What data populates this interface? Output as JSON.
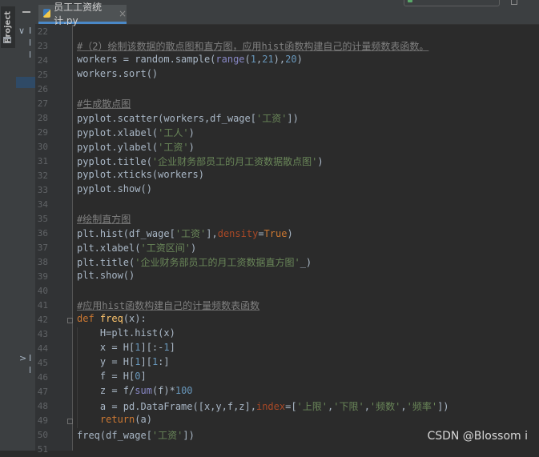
{
  "sidebar": {
    "project_label": "Project"
  },
  "tab": {
    "filename": "员工工资统计.py",
    "close_glyph": "×"
  },
  "tree": {
    "chevron_open": "∨",
    "chevron_closed": ">"
  },
  "lines": [
    {
      "n": "22",
      "segs": []
    },
    {
      "n": "23",
      "segs": [
        {
          "t": "#（2）绘制该数据的散点图和直方图，应用hist函数构建自己的计量频数表函数。",
          "c": "cm"
        }
      ]
    },
    {
      "n": "24",
      "segs": [
        {
          "t": "workers = random.sample("
        },
        {
          "t": "range",
          "c": "bi"
        },
        {
          "t": "("
        },
        {
          "t": "1",
          "c": "num"
        },
        {
          "t": ","
        },
        {
          "t": "21",
          "c": "num"
        },
        {
          "t": "),"
        },
        {
          "t": "20",
          "c": "num"
        },
        {
          "t": ")"
        }
      ]
    },
    {
      "n": "25",
      "segs": [
        {
          "t": "workers.sort()"
        }
      ]
    },
    {
      "n": "26",
      "segs": []
    },
    {
      "n": "27",
      "segs": [
        {
          "t": "#生成散点图",
          "c": "cm"
        }
      ]
    },
    {
      "n": "28",
      "segs": [
        {
          "t": "pyplot.scatter(workers,df_wage["
        },
        {
          "t": "'工资'",
          "c": "str"
        },
        {
          "t": "])"
        }
      ]
    },
    {
      "n": "29",
      "segs": [
        {
          "t": "pyplot.xlabel("
        },
        {
          "t": "'工人'",
          "c": "str"
        },
        {
          "t": ")"
        }
      ]
    },
    {
      "n": "30",
      "segs": [
        {
          "t": "pyplot.ylabel("
        },
        {
          "t": "'工资'",
          "c": "str"
        },
        {
          "t": ")"
        }
      ]
    },
    {
      "n": "31",
      "segs": [
        {
          "t": "pyplot.title("
        },
        {
          "t": "'企业财务部员工的月工资数据散点图'",
          "c": "str"
        },
        {
          "t": ")"
        }
      ]
    },
    {
      "n": "32",
      "segs": [
        {
          "t": "pyplot.xticks(workers)"
        }
      ]
    },
    {
      "n": "33",
      "segs": [
        {
          "t": "pyplot.show()"
        }
      ]
    },
    {
      "n": "34",
      "segs": []
    },
    {
      "n": "35",
      "segs": [
        {
          "t": "#绘制直方图",
          "c": "cm"
        }
      ]
    },
    {
      "n": "36",
      "segs": [
        {
          "t": "plt.hist(df_wage["
        },
        {
          "t": "'工资'",
          "c": "str"
        },
        {
          "t": "],"
        },
        {
          "t": "density",
          "c": "kwarg"
        },
        {
          "t": "="
        },
        {
          "t": "True",
          "c": "kw"
        },
        {
          "t": ")"
        }
      ]
    },
    {
      "n": "37",
      "segs": [
        {
          "t": "plt.xlabel("
        },
        {
          "t": "'工资区间'",
          "c": "str"
        },
        {
          "t": ")"
        }
      ]
    },
    {
      "n": "38",
      "segs": [
        {
          "t": "plt.title("
        },
        {
          "t": "'企业财务部员工的月工资数据直方图'",
          "c": "str"
        },
        {
          "t": "_)"
        }
      ]
    },
    {
      "n": "39",
      "segs": [
        {
          "t": "plt.show()"
        }
      ]
    },
    {
      "n": "40",
      "segs": []
    },
    {
      "n": "41",
      "segs": [
        {
          "t": "#应用hist函数构建自己的计量频数表函数",
          "c": "cm"
        }
      ]
    },
    {
      "n": "42",
      "segs": [
        {
          "t": "def ",
          "c": "kw"
        },
        {
          "t": "freq",
          "c": "fnd"
        },
        {
          "t": "(x):"
        }
      ]
    },
    {
      "n": "43",
      "segs": [
        {
          "t": "    H=plt.hist(x)"
        }
      ]
    },
    {
      "n": "44",
      "segs": [
        {
          "t": "    x = H["
        },
        {
          "t": "1",
          "c": "num"
        },
        {
          "t": "][:-"
        },
        {
          "t": "1",
          "c": "num"
        },
        {
          "t": "]"
        }
      ]
    },
    {
      "n": "45",
      "segs": [
        {
          "t": "    y = H["
        },
        {
          "t": "1",
          "c": "num"
        },
        {
          "t": "]["
        },
        {
          "t": "1",
          "c": "num"
        },
        {
          "t": ":]"
        }
      ]
    },
    {
      "n": "46",
      "segs": [
        {
          "t": "    f = H["
        },
        {
          "t": "0",
          "c": "num"
        },
        {
          "t": "]"
        }
      ]
    },
    {
      "n": "47",
      "segs": [
        {
          "t": "    z = f/"
        },
        {
          "t": "sum",
          "c": "bi"
        },
        {
          "t": "(f)*"
        },
        {
          "t": "100",
          "c": "num"
        }
      ]
    },
    {
      "n": "48",
      "segs": [
        {
          "t": "    a = pd.DataFrame([x,y,f,z],"
        },
        {
          "t": "index",
          "c": "kwarg"
        },
        {
          "t": "=["
        },
        {
          "t": "'上限'",
          "c": "str"
        },
        {
          "t": ","
        },
        {
          "t": "'下限'",
          "c": "str"
        },
        {
          "t": ","
        },
        {
          "t": "'频数'",
          "c": "str"
        },
        {
          "t": ","
        },
        {
          "t": "'频率'",
          "c": "str"
        },
        {
          "t": "])"
        }
      ]
    },
    {
      "n": "49",
      "segs": [
        {
          "t": "    "
        },
        {
          "t": "return",
          "c": "kw"
        },
        {
          "t": "(a)"
        }
      ]
    },
    {
      "n": "50",
      "segs": [
        {
          "t": "freq(df_wage["
        },
        {
          "t": "'工资'",
          "c": "str"
        },
        {
          "t": "])"
        }
      ]
    },
    {
      "n": "51",
      "segs": []
    }
  ],
  "watermark": "CSDN @Blossom i"
}
